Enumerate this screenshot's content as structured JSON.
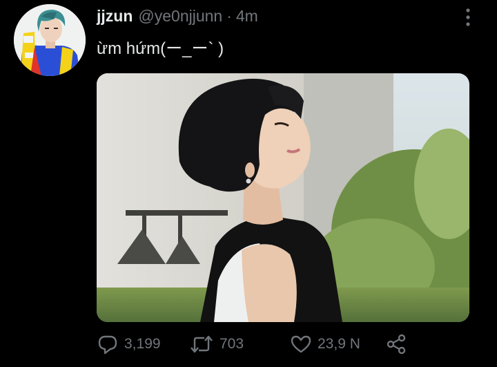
{
  "tweet": {
    "display_name": "jjzun",
    "handle": "@ye0njjunn",
    "separator": "·",
    "time": "4m",
    "text": "ừm hứm(ー_ー` )"
  },
  "avatar": {
    "icon": "profile-photo"
  },
  "media": {
    "icon": "tweet-photo"
  },
  "actions": {
    "reply_count": "3,199",
    "retweet_count": "703",
    "like_count": "23,9 N",
    "reply_icon": "speech-bubble-icon",
    "retweet_icon": "retweet-arrows-icon",
    "like_icon": "heart-icon",
    "share_icon": "share-nodes-icon"
  },
  "colors": {
    "background": "#000000",
    "primary_text": "#e7e9ea",
    "secondary_text": "#71767b"
  }
}
